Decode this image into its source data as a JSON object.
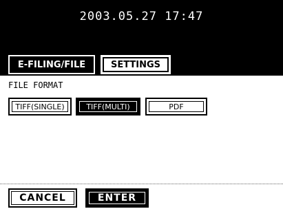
{
  "header": {
    "datetime": "2003.05.27 17:47"
  },
  "tabs": [
    {
      "label": "E-FILING/FILE",
      "selected": true
    },
    {
      "label": "SETTINGS",
      "selected": false
    }
  ],
  "file_format": {
    "label": "FILE FORMAT",
    "options": [
      {
        "label": "TIFF(SINGLE)",
        "selected": false
      },
      {
        "label": "TIFF(MULTI)",
        "selected": true
      },
      {
        "label": "PDF",
        "selected": false
      }
    ]
  },
  "actions": {
    "cancel_label": "CANCEL",
    "enter_label": "ENTER"
  }
}
